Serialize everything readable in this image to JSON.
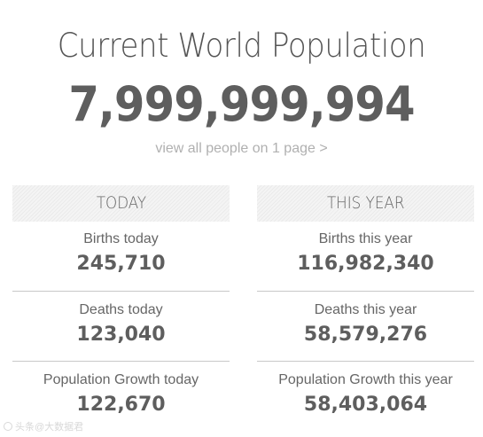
{
  "header": {
    "title": "Current World Population",
    "counter": "7,999,999,994",
    "view_link": "view all people on 1 page >"
  },
  "today": {
    "heading": "TODAY",
    "stats": [
      {
        "label": "Births today",
        "value": "245,710"
      },
      {
        "label": "Deaths today",
        "value": "123,040"
      },
      {
        "label": "Population Growth today",
        "value": "122,670"
      }
    ]
  },
  "this_year": {
    "heading": "THIS YEAR",
    "stats": [
      {
        "label": "Births this year",
        "value": "116,982,340"
      },
      {
        "label": "Deaths this year",
        "value": "58,579,276"
      },
      {
        "label": "Population Growth this year",
        "value": "58,403,064"
      }
    ]
  },
  "watermark": {
    "text": "头条@大数据君"
  }
}
